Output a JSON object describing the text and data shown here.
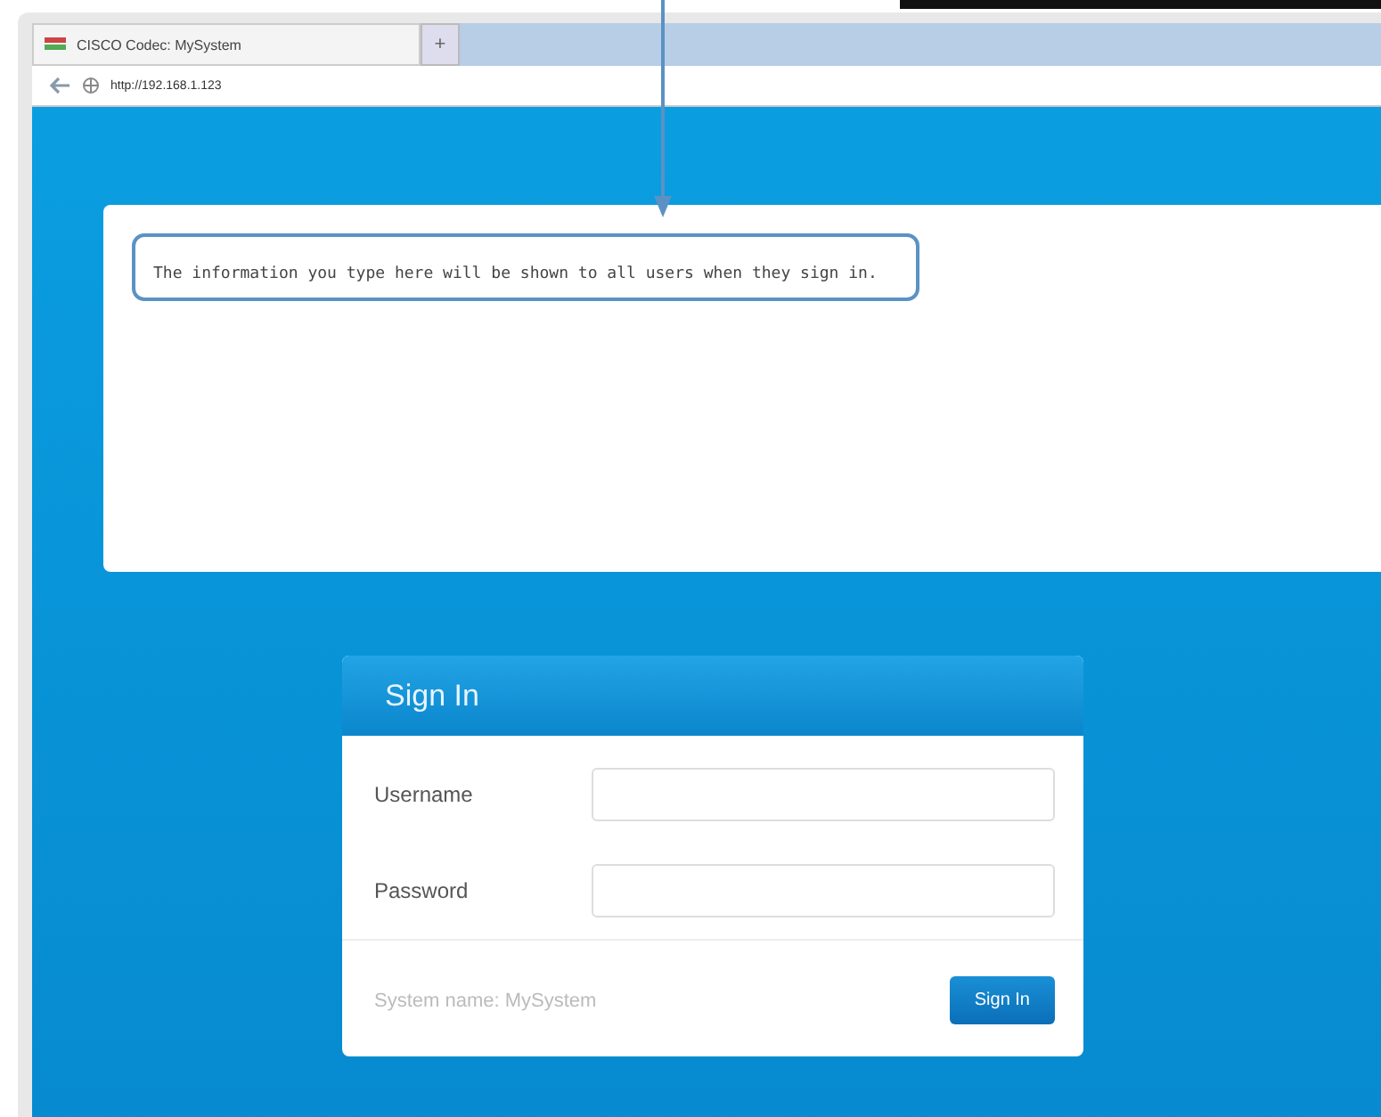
{
  "browser": {
    "tab_title": "CISCO Codec: MySystem",
    "new_tab": "+",
    "address": "http://192.168.1.123"
  },
  "banner": {
    "text": "The information you type here will be shown to all users when they sign in."
  },
  "sign_in": {
    "title": "Sign In",
    "fields": [
      {
        "label": "Username"
      },
      {
        "label": "Password"
      }
    ],
    "system_name": "System name: MySystem",
    "button": "Sign In"
  }
}
